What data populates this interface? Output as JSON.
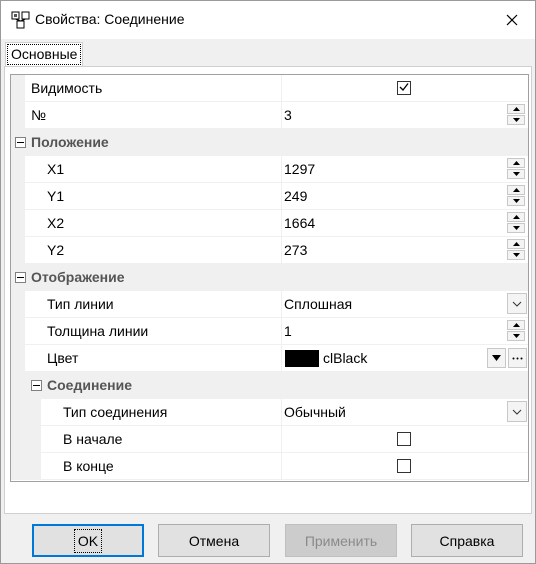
{
  "window": {
    "title": "Свойства: Соединение"
  },
  "tabs": [
    {
      "label": "Основные",
      "active": true
    }
  ],
  "properties": {
    "visibility": {
      "name": "Видимость",
      "checked": true
    },
    "number": {
      "name": "№",
      "value": "3"
    },
    "position": {
      "label": "Положение",
      "x1": {
        "name": "X1",
        "value": "1297"
      },
      "y1": {
        "name": "Y1",
        "value": "249"
      },
      "x2": {
        "name": "X2",
        "value": "1664"
      },
      "y2": {
        "name": "Y2",
        "value": "273"
      }
    },
    "display": {
      "label": "Отображение",
      "line_type": {
        "name": "Тип линии",
        "value": "Сплошная"
      },
      "line_width": {
        "name": "Толщина линии",
        "value": "1"
      },
      "color": {
        "name": "Цвет",
        "value": "clBlack",
        "swatch": "#000000"
      },
      "connection": {
        "label": "Соединение",
        "type": {
          "name": "Тип соединения",
          "value": "Обычный"
        },
        "at_start": {
          "name": "В начале",
          "checked": false
        },
        "at_end": {
          "name": "В конце",
          "checked": false
        }
      }
    }
  },
  "buttons": {
    "ok": "OK",
    "cancel": "Отмена",
    "apply": "Применить",
    "help": "Справка"
  },
  "icons": {
    "app": "app-icon",
    "close": "close-icon",
    "collapse": "collapse-icon",
    "checkmark": "checkmark-icon",
    "spin_up": "spin-up-icon",
    "spin_down": "spin-down-icon",
    "dropdown": "chevron-down-icon"
  },
  "colors": {
    "accent": "#0078d7",
    "category_bg": "#f0f0f0"
  }
}
